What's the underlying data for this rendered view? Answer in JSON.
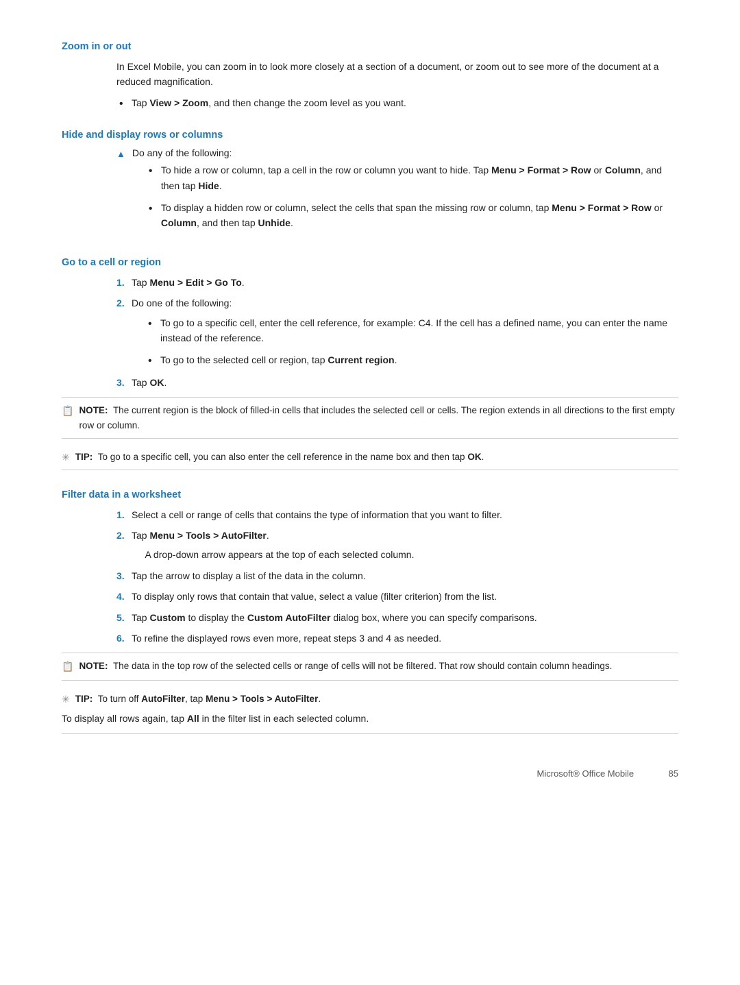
{
  "sections": [
    {
      "id": "zoom",
      "heading": "Zoom in or out",
      "body": "In Excel Mobile, you can zoom in to look more closely at a section of a document, or zoom out to see more of the document at a reduced magnification.",
      "bullets": [
        "Tap <b>View > Zoom</b>, and then change the zoom level as you want."
      ]
    },
    {
      "id": "hide-display",
      "heading": "Hide and display rows or columns",
      "triangle_label": "Do any of the following:",
      "sub_bullets": [
        "To hide a row or column, tap a cell in the row or column you want to hide. Tap <b>Menu > Format > Row</b> or <b>Column</b>, and then tap <b>Hide</b>.",
        "To display a hidden row or column, select the cells that span the missing row or column, tap <b>Menu > Format > Row</b> or <b>Column</b>, and then tap <b>Unhide</b>."
      ]
    },
    {
      "id": "goto",
      "heading": "Go to a cell or region",
      "steps": [
        "Tap <b>Menu > Edit > Go To</b>.",
        "Do one of the following:",
        "Tap <b>OK</b>."
      ],
      "step2_bullets": [
        "To go to a specific cell, enter the cell reference, for example: C4. If the cell has a defined name, you can enter the name instead of the reference.",
        "To go to the selected cell or region, tap <b>Current region</b>."
      ],
      "note": "The current region is the block of filled-in cells that includes the selected cell or cells. The region extends in all directions to the first empty row or column.",
      "tip": "To go to a specific cell, you can also enter the cell reference in the name box and then tap <b>OK</b>."
    },
    {
      "id": "filter",
      "heading": "Filter data in a worksheet",
      "steps": [
        "Select a cell or range of cells that contains the type of information that you want to filter.",
        "Tap <b>Menu > Tools > AutoFilter</b>.",
        "Tap the arrow to display a list of the data in the column.",
        "To display only rows that contain that value, select a value (filter criterion) from the list.",
        "Tap <b>Custom</b> to display the <b>Custom AutoFilter</b> dialog box, where you can specify comparisons.",
        "To refine the displayed rows even more, repeat steps 3 and 4 as needed."
      ],
      "step2_sub": "A drop-down arrow appears at the top of each selected column.",
      "note": "The data in the top row of the selected cells or range of cells will not be filtered. That row should contain column headings.",
      "tip": "To turn off <b>AutoFilter</b>, tap <b>Menu > Tools > AutoFilter</b>.",
      "tip2": "To display all rows again, tap <b>All</b> in the filter list in each selected column."
    }
  ],
  "footer": {
    "brand": "Microsoft® Office Mobile",
    "page": "85"
  },
  "icons": {
    "note": "📋",
    "tip": "✳",
    "triangle": "▲",
    "bullet": "•"
  }
}
